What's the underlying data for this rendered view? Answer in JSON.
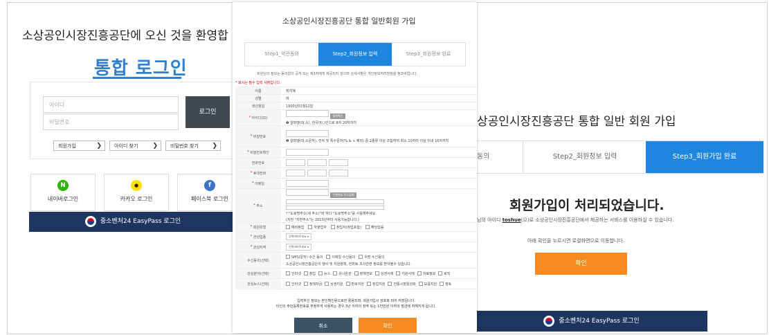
{
  "login": {
    "welcome": "소상공인시장진흥공단에 오신 것을 환영합",
    "title": "통합 로그인",
    "id_placeholder": "아이디",
    "pw_placeholder": "비밀번호",
    "login_button": "로그인",
    "links": [
      {
        "label": "회원가입",
        "chevron": "❯"
      },
      {
        "label": "아이디 찾기",
        "chevron": "❯"
      },
      {
        "label": "비밀번호 찾기",
        "chevron": "❯"
      }
    ],
    "social": [
      {
        "icon": "N",
        "label": "네이버로그인",
        "color": "#2db400"
      },
      {
        "icon": "●",
        "label": "카카오 로그인",
        "color": "#fae100"
      },
      {
        "icon": "f",
        "label": "페이스북 로그인",
        "color": "#3b73c8"
      }
    ],
    "easypass": "중소벤처24 EasyPass 로그인"
  },
  "signup": {
    "title": "소상공인시장진흥공단 통합 일반회원 가입",
    "steps": [
      "Step1_약관동의",
      "Step2_회원정보 입력",
      "Step3_회원정보 완료"
    ],
    "notice": "회원님의 정보는 동의없이 공개 또는 제3자에게 제공되지 않으며 상세사항은 개인정보처리방침을 참조바랍니다.",
    "required_note": "* 표시는 필수 입력 사항입니다.",
    "fields": [
      {
        "label": "이름",
        "value": "최지혜"
      },
      {
        "label": "성별",
        "value": "여"
      },
      {
        "label": "생년월일",
        "value": "1900년01월12일"
      },
      {
        "label": "* 아이디(ID)",
        "button": "중복확인",
        "hint": "❶ 알파벳(대,소), 한국어(,)인으로 8자 20자까지"
      },
      {
        "label": "* 비밀번호",
        "hint": "❶ 알파벳(대,소문자), 숫자 및 특수문자(%,& + 제외) 중 2종류 이상 조합하여 최소 10자리 이상 이내 16자까지"
      },
      {
        "label": "* 비밀번호확인"
      },
      {
        "label": "전화번호"
      },
      {
        "label": "* 휴대전화"
      },
      {
        "label": "* 이메일"
      },
      {
        "label": "* 주소",
        "button": "우편번호 주소검색",
        "hint": "* \"도로명주소(새 주소)\"와 하다 \"도로명주소\"를 사용해주세요.",
        "hint2": "(지번 \"지번주소\"는 2013년부터 사용가능합니다.)"
      },
      {
        "label": "* 회원유형",
        "options": [
          "예비창업",
          "자영업자",
          "창업자(창업포함)",
          "해당없음"
        ]
      },
      {
        "label": "* 관심업종",
        "select": "선택하여주세요"
      },
      {
        "label": "* 관심지역",
        "select": "선택하여주세요"
      },
      {
        "label": "수신동의(선택)",
        "options": [
          "SMS(문자) 수신 동의",
          "이메일 수신동의",
          "우편 수신동의"
        ],
        "hint": "소상공인시장진흥공단의 행사 및 지원정책, 컨퍼토 조사관련 정보를 받아볼수 있습니다."
      },
      {
        "label": "관심분야(선택)",
        "options": [
          "인터넷",
          "창업",
          "뉴스",
          "유니온관",
          "정책전보",
          "상권사례",
          "지원사례",
          "자료정보",
          "로직"
        ]
      },
      {
        "label": "관심뉴스(선택)",
        "options": [
          "인터넷",
          "정책자금",
          "상권지원",
          "판로지원",
          "창업지원",
          "전통시장활성화",
          "보증지원",
          "컴토"
        ]
      }
    ],
    "footnote1": "입력하신 정보는 본인확인용으로만 활용되며, 회원가입시 암호화 되어 저장됩니다.",
    "footnote2": "타인의 주민등록번호를 부정하게 사용하는 경우 3년 이하의 징역 또는 1천만원 이하의 벌금에 처해지게 됩니다.",
    "cancel": "취소",
    "confirm": "확인"
  },
  "complete": {
    "title": "상공인시장진흥공단 통합 일반 회원 가입",
    "steps": [
      "동의",
      "Step2_회원정보 입력",
      "Step3_회원가입 완료"
    ],
    "heading": "회원가입이 처리되었습니다.",
    "desc_pre": "님의 아이디 ",
    "desc_id": "toshue",
    "desc_post": "(으)로 소상공인시장진흥공단에서 제공하는 서비스를 이용하실 수 있습니다.",
    "move_note": "아래 확인을 누르시면 로컬화면으로 이동합니다.",
    "confirm": "확인",
    "easypass": "중소벤처24 EasyPass 로그인"
  },
  "colors": {
    "brand_blue": "#2f7fd0",
    "step_active": "#1f86e0",
    "orange": "#f58a1f",
    "navy": "#1e3560"
  }
}
